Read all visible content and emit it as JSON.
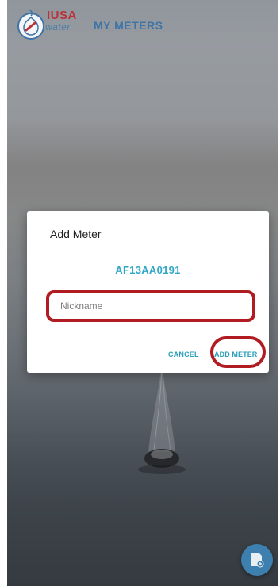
{
  "header": {
    "brand_top": "IUSA",
    "brand_bottom": "water",
    "title": "MY METERS"
  },
  "dialog": {
    "title": "Add Meter",
    "meter_id": "AF13AA0191",
    "nickname_placeholder": "Nickname",
    "nickname_value": "",
    "cancel_label": "CANCEL",
    "add_label": "ADD METER"
  },
  "fab": {
    "icon": "add-document-icon"
  },
  "colors": {
    "accent": "#2fa7c5",
    "brand_red": "#b8323a",
    "brand_blue": "#3f74a6",
    "highlight": "#b01c22"
  }
}
